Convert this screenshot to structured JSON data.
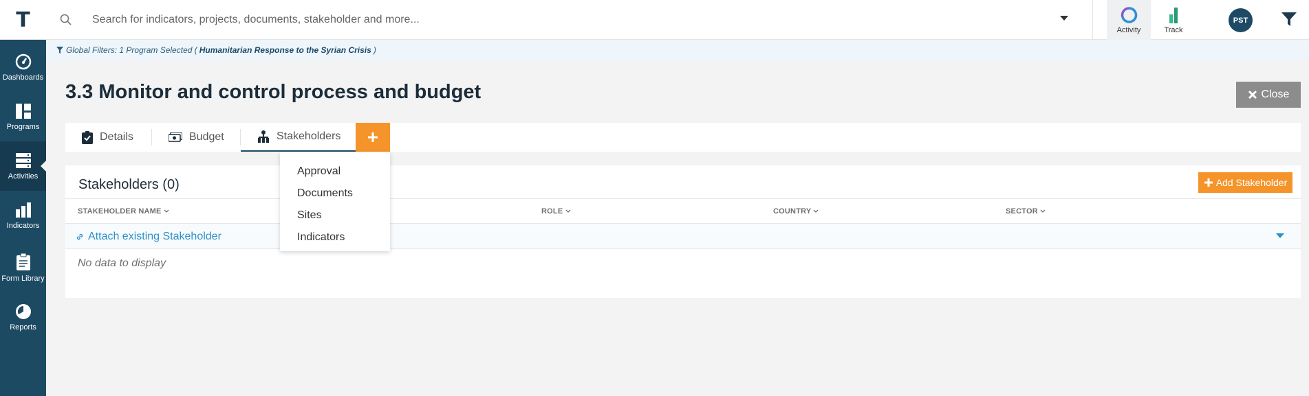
{
  "app": {
    "logo_letter": "T"
  },
  "search": {
    "placeholder": "Search for indicators, projects, documents, stakeholder and more..."
  },
  "top_tabs": [
    {
      "label": "Activity",
      "icon": "activity-icon"
    },
    {
      "label": "Track",
      "icon": "track-icon"
    }
  ],
  "user": {
    "initials": "PST"
  },
  "sidebar": {
    "items": [
      {
        "label": "Dashboards",
        "icon": "gauge-icon"
      },
      {
        "label": "Programs",
        "icon": "grid-icon"
      },
      {
        "label": "Activities",
        "icon": "server-icon",
        "active": true
      },
      {
        "label": "Indicators",
        "icon": "bar-chart-icon"
      },
      {
        "label": "Form Library",
        "icon": "clipboard-icon"
      },
      {
        "label": "Reports",
        "icon": "pie-chart-icon"
      }
    ]
  },
  "global_filter": {
    "prefix": "Global Filters: 1 Program Selected (",
    "program": "Humanitarian Response to the Syrian Crisis",
    "suffix": ")"
  },
  "page": {
    "title": "3.3 Monitor and control process and budget",
    "close_label": "Close"
  },
  "tabs": [
    {
      "label": "Details",
      "icon": "clipboard-check-icon"
    },
    {
      "label": "Budget",
      "icon": "money-icon"
    },
    {
      "label": "Stakeholders",
      "icon": "hierarchy-icon",
      "active": true
    }
  ],
  "add_menu": {
    "items": [
      "Approval",
      "Documents",
      "Sites",
      "Indicators"
    ]
  },
  "stakeholders": {
    "title": "Stakeholders (0)",
    "add_label": "Add Stakeholder",
    "columns": [
      "STAKEHOLDER NAME",
      "ROLE",
      "COUNTRY",
      "SECTOR"
    ],
    "attach_label": "Attach existing Stakeholder",
    "empty_text": "No data to display"
  },
  "colors": {
    "sidebar": "#1d4a63",
    "accent": "#f4942a",
    "link": "#2e90c5",
    "close": "#8c8c8c"
  }
}
